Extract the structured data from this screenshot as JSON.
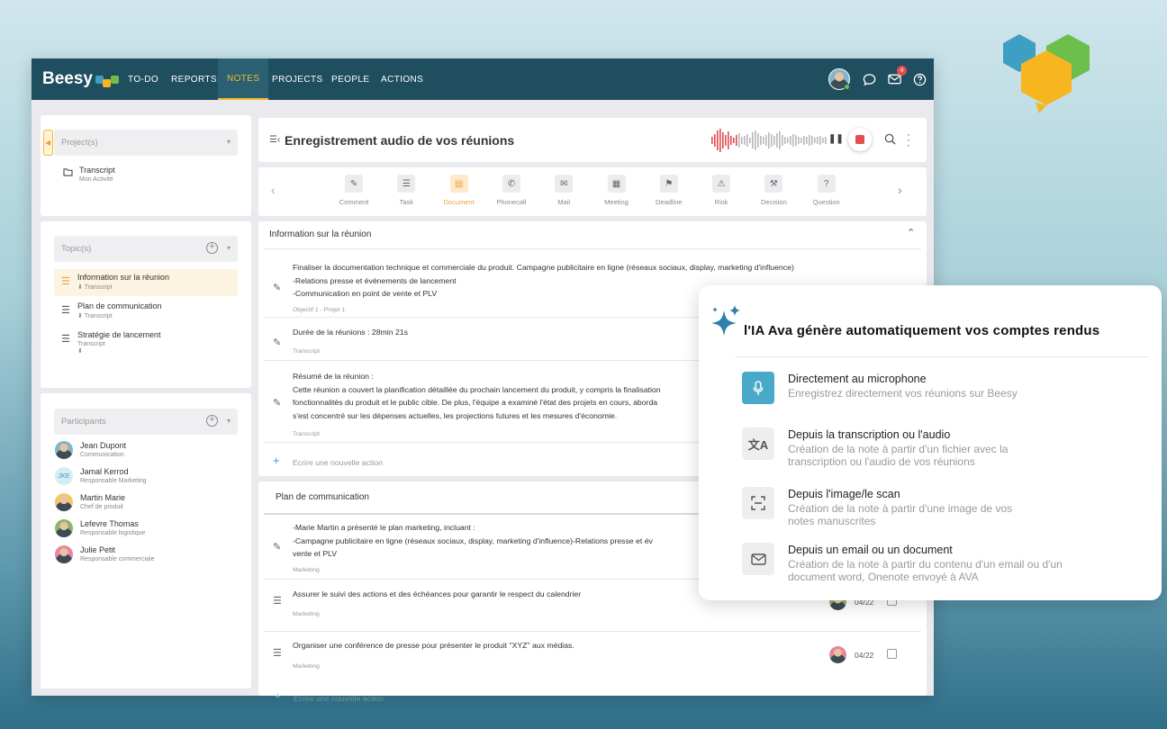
{
  "topbar": {
    "brand": "Beesy",
    "nav": [
      "TO-DO",
      "REPORTS",
      "NOTES",
      "PROJECTS",
      "PEOPLE",
      "ACTIONS"
    ],
    "active": "NOTES",
    "mail_badge": "4"
  },
  "projects_panel": {
    "placeholder": "Project(s)",
    "items": [
      {
        "title": "Transcript",
        "subtitle": "Mon Activité"
      }
    ]
  },
  "topics_panel": {
    "placeholder": "Topic(s)",
    "items": [
      {
        "title": "Information sur la réunion",
        "subtitle": "Transcript"
      },
      {
        "title": "Plan de communication",
        "subtitle": "Transcript"
      },
      {
        "title": "Stratégie de lancement",
        "subtitle": "Transcript"
      }
    ]
  },
  "participants_panel": {
    "placeholder": "Participants",
    "items": [
      {
        "name": "Jean Dupont",
        "role": "Communication"
      },
      {
        "name": "Jamal Kerrod",
        "role": "Responsable Marketing",
        "initials": "JKE"
      },
      {
        "name": "Martin Marie",
        "role": "Chef de produit"
      },
      {
        "name": "Lefevre Thomas",
        "role": "Responsable logistique"
      },
      {
        "name": "Julie Petit",
        "role": "Responsable commerciale"
      }
    ]
  },
  "header": {
    "title": "Enregistrement audio de vos réunions"
  },
  "toolbar": {
    "items": [
      {
        "label": "Comment",
        "icon": "pencil-icon"
      },
      {
        "label": "Task",
        "icon": "checklist-icon"
      },
      {
        "label": "Document",
        "icon": "document-icon"
      },
      {
        "label": "Phonecall",
        "icon": "phone-icon"
      },
      {
        "label": "Mail",
        "icon": "mail-icon"
      },
      {
        "label": "Meeting",
        "icon": "calendar-icon"
      },
      {
        "label": "Deadline",
        "icon": "flag-icon"
      },
      {
        "label": "Risk",
        "icon": "warning-icon"
      },
      {
        "label": "Decision",
        "icon": "gavel-icon"
      },
      {
        "label": "Question",
        "icon": "question-icon"
      }
    ],
    "active": "Document"
  },
  "section1": {
    "title": "Information sur la réunion",
    "notes": [
      {
        "lines": [
          "Finaliser la documentation technique et commerciale du produit.  Campagne publicitaire en ligne (réseaux sociaux, display, marketing d'influence)",
          "-Relations presse et événements de lancement",
          "-Communication en point de vente et PLV"
        ],
        "sub": "Objectif 1 - Projet 1"
      },
      {
        "lines": [
          "Durée de la réunions : 28min 21s"
        ],
        "sub": "Transcript"
      },
      {
        "lines": [
          "Résumé de la réunion :",
          "Cette réunion a couvert la planification détaillée du prochain lancement du produit, y compris la finalisation",
          "fonctionnalités du produit et le public cible. De plus, l'équipe a examiné l'état des projets en cours, aborda",
          "s'est concentré sur les dépenses actuelles, les projections futures et les mesures d'économie."
        ],
        "sub": "Transcript"
      }
    ],
    "new_action": "Ecrire une nouvelle action"
  },
  "section2": {
    "title": "Plan de communication",
    "notes": [
      {
        "lines": [
          "-Marie Martin a présenté le plan marketing, incluant :",
          "-Campagne publicitaire en ligne (réseaux sociaux, display, marketing d'influence)-Relations presse et év",
          "vente et PLV"
        ],
        "sub": "Marketing"
      },
      {
        "lines": [
          "Assurer le suivi des actions et des échéances pour garantir le respect du calendrier"
        ],
        "sub": "Marketing",
        "date": "04/22"
      },
      {
        "lines": [
          "Organiser une conférence de presse pour présenter le produit \"XYZ\" aux médias."
        ],
        "sub": "Marketing",
        "date": "04/22"
      }
    ],
    "new_action": "Ecrire une nouvelle action"
  },
  "ava": {
    "title": "l'IA Ava génère automatiquement  vos  comptes rendus",
    "features": [
      {
        "icon": "microphone-icon",
        "title": "Directement au microphone",
        "desc": "Enregistrez directement vos réunions sur Beesy"
      },
      {
        "icon": "translate-icon",
        "title": "Depuis la transcription ou l'audio",
        "desc": "Création de la note à partir d'un fichier avec la transcription ou l'audio de vos réunions"
      },
      {
        "icon": "scan-icon",
        "title": "Depuis l'image/le scan",
        "desc": "Création de la note à partir d'une image de vos notes manuscrites"
      },
      {
        "icon": "mail-icon",
        "title": "Depuis un email ou un document",
        "desc": "Création de la note à partir du contenu d'un email ou d'un document word, Onenote  envoyé à AVA"
      }
    ]
  },
  "colors": {
    "topbar": "#1f4e5f",
    "accent": "#f5b82e",
    "record": "#e24d4d",
    "ava_blue": "#4aa8c9"
  }
}
